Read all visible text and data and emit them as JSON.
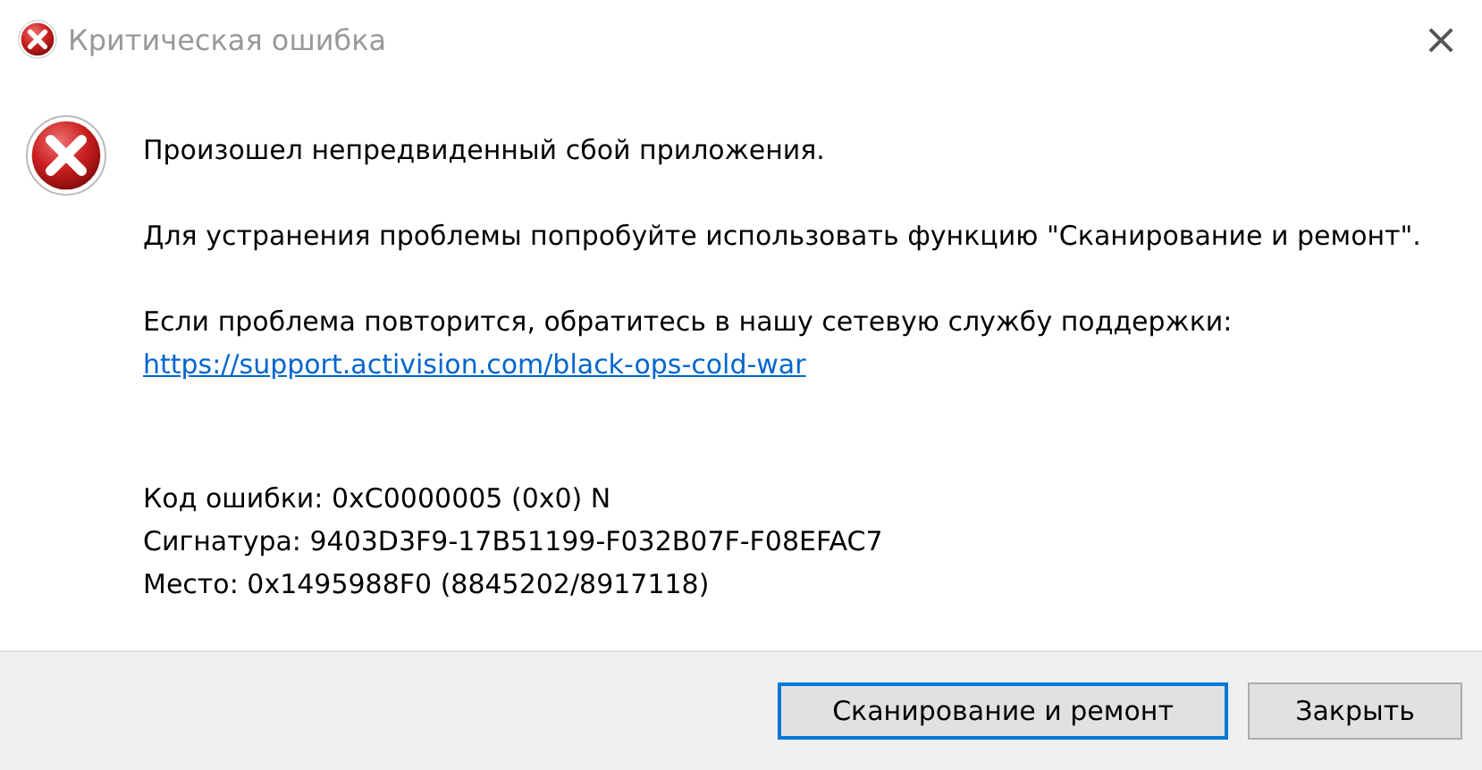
{
  "window": {
    "title": "Критическая ошибка",
    "close": "×"
  },
  "message": {
    "headline": "Произошел непредвиденный сбой приложения.",
    "hint": "Для устранения проблемы попробуйте использовать функцию \"Сканирование и ремонт\".",
    "support": "Если проблема повторится, обратитесь в нашу сетевую службу поддержки:",
    "link": "https://support.activision.com/black-ops-cold-war"
  },
  "details": [
    "Код ошибки: 0xC0000005 (0x0) N",
    "Сигнатура: 9403D3F9-17B51199-F032B07F-F08EFAC7",
    "Место: 0x1495988F0 (8845202/8917118)"
  ],
  "buttons": [
    {
      "label": "Сканирование и ремонт",
      "focused": true
    },
    {
      "label": "Закрыть",
      "focused": false
    }
  ]
}
